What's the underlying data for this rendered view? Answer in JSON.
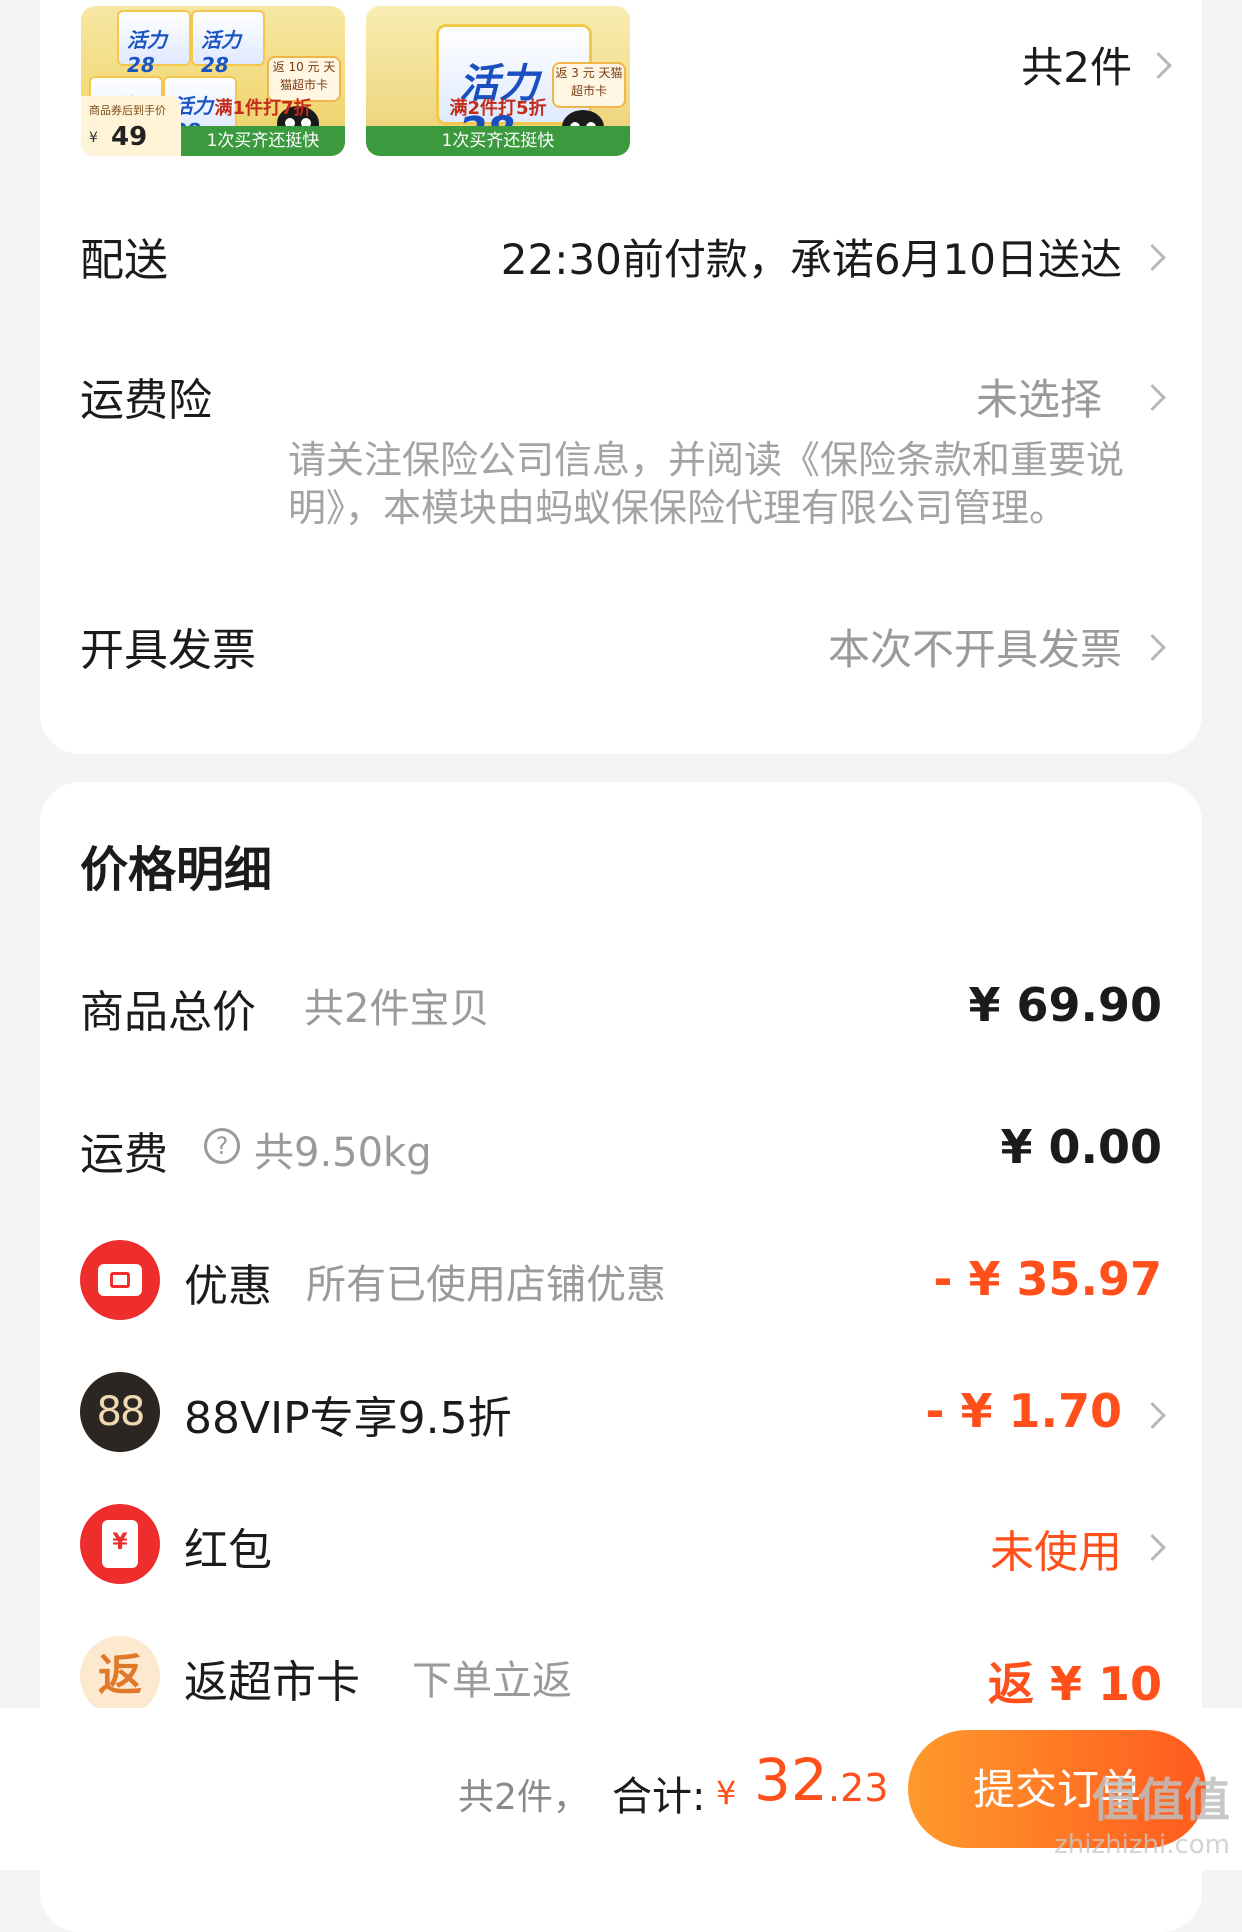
{
  "items_summary": {
    "count_label": "共2件",
    "thumb1": {
      "brand": "活力28",
      "rebate": "返 10 元 天猫超市卡",
      "price_label": "商品券后到手价",
      "price_yen": "¥",
      "price": "49",
      "promo": "满1件打7折",
      "strip": "1次买齐还挺快"
    },
    "thumb2": {
      "brand": "活力28",
      "rebate": "返 3 元 天猫超市卡",
      "promo": "满2件打5折",
      "strip": "1次买齐还挺快"
    }
  },
  "delivery": {
    "label": "配送",
    "value": "22:30前付款，承诺6月10日送达"
  },
  "shipping_insurance": {
    "label": "运费险",
    "value": "未选择",
    "note": "请关注保险公司信息，并阅读《保险条款和重要说明》，本模块由蚂蚁保保险代理有限公司管理。"
  },
  "invoice": {
    "label": "开具发票",
    "value": "本次不开具发票"
  },
  "price_detail": {
    "title": "价格明细",
    "goods_total": {
      "label": "商品总价",
      "sub": "共2件宝贝",
      "amount": "¥ 69.90"
    },
    "shipping": {
      "label": "运费",
      "help": "?",
      "sub": "共9.50kg",
      "amount": "¥ 0.00"
    },
    "discount": {
      "label": "优惠",
      "sub": "所有已使用店铺优惠",
      "amount": "- ¥ 35.97"
    },
    "vip": {
      "icon_text": "88",
      "label": "88VIP专享9.5折",
      "amount": "- ¥ 1.70"
    },
    "red_packet": {
      "icon_text": "¥",
      "label": "红包",
      "value": "未使用"
    },
    "rebate_card": {
      "icon_text": "返",
      "label": "返超市卡",
      "sub": "下单立返",
      "amount": "返 ¥ 10"
    }
  },
  "bottom_bar": {
    "count": "共2件，",
    "total_label": "合计:",
    "yen": "¥",
    "total_int": "32",
    "total_dec": ".23",
    "submit": "提交订单"
  },
  "watermark": {
    "logo": "值值值",
    "text": "zhizhizhi.com"
  },
  "colors": {
    "accent_red": "#ff4f1a",
    "icon_red": "#ee2d2d",
    "vip_dark": "#2c2623",
    "muted_text": "#9a9a9a",
    "submit_gradient_start": "#ff9a2c",
    "submit_gradient_end": "#ff5a1e",
    "promo_green": "#3a9a3d"
  }
}
